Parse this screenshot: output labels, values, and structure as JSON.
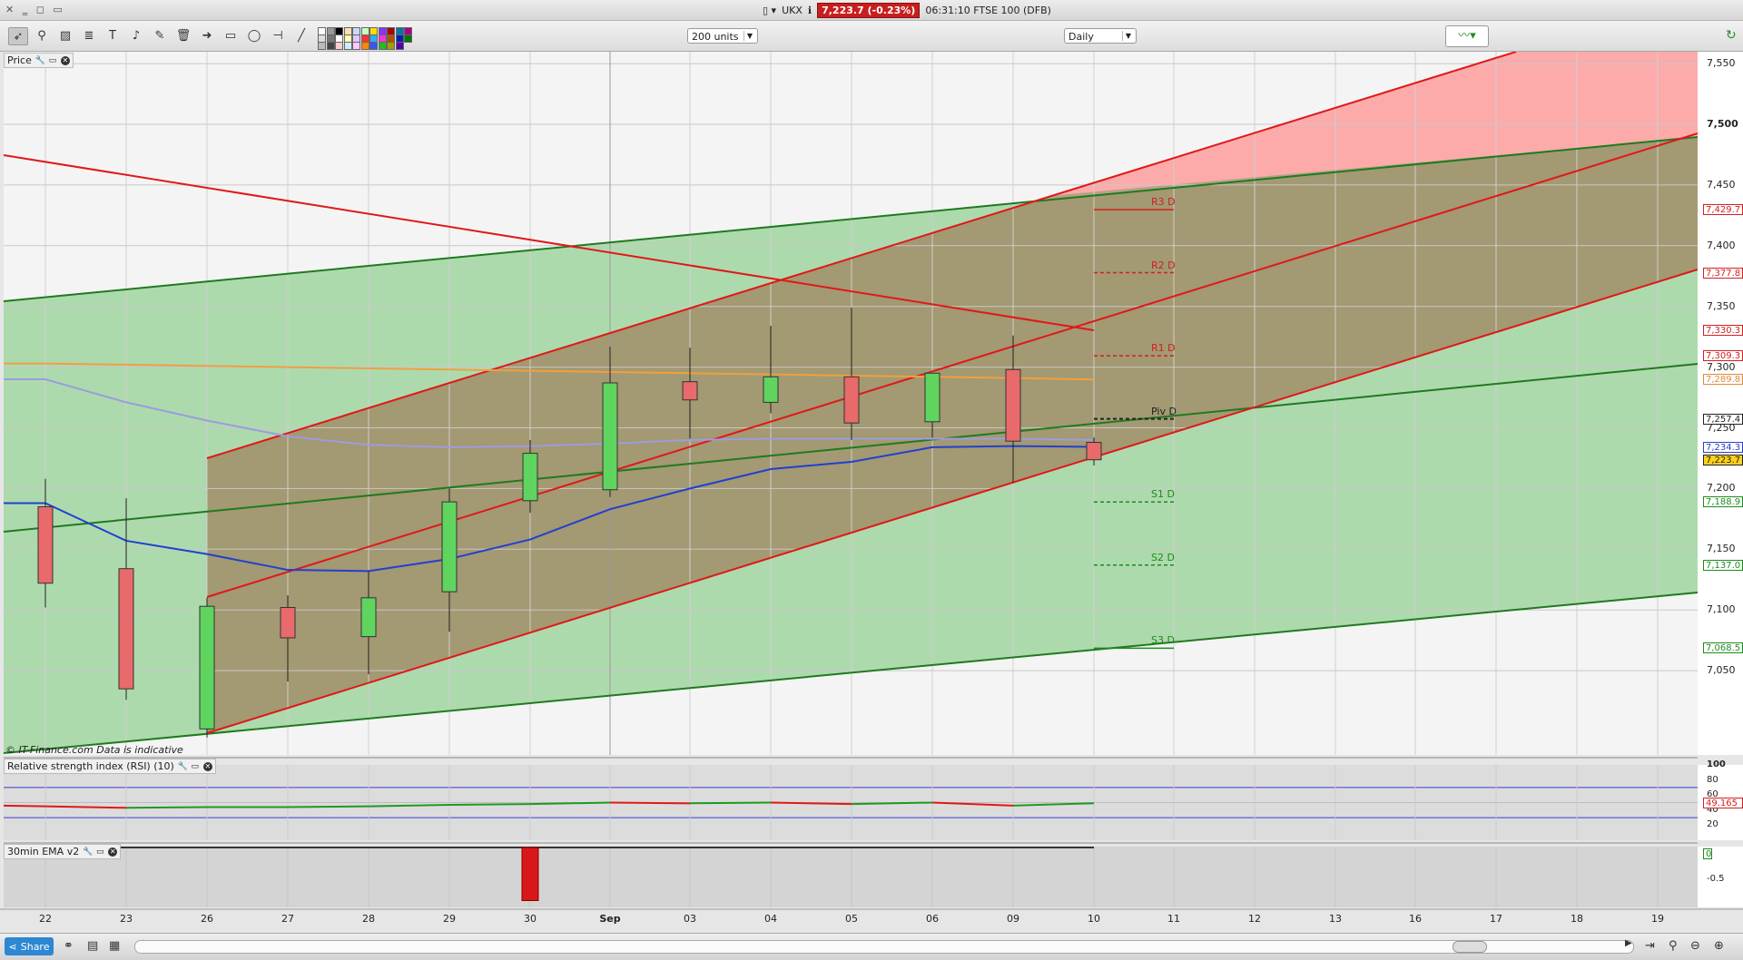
{
  "window": {
    "title": "UKX",
    "price_badge": "7,223.7 (-0.23%)",
    "time_instrument": "06:31:10 FTSE 100 (DFB)"
  },
  "toolbar": {
    "units_select": "200 units",
    "interval_select": "Daily"
  },
  "price_panel": {
    "label": "Price",
    "copyright": "© IT-Finance.com  Data is indicative",
    "y_ticks": [
      "7,550",
      "7,500",
      "7,450",
      "7,400",
      "7,350",
      "7,300",
      "7,250",
      "7,200",
      "7,150",
      "7,100",
      "7,050"
    ],
    "price_tags": [
      {
        "text": "7,429.7",
        "color": "#d22020"
      },
      {
        "text": "7,377.8",
        "color": "#d22020"
      },
      {
        "text": "7,330.3",
        "color": "#d22020"
      },
      {
        "text": "7,309.3",
        "color": "#d22020"
      },
      {
        "text": "7,289.8",
        "color": "#e08a3a"
      },
      {
        "text": "7,257.4",
        "color": "#222222"
      },
      {
        "text": "7,234.3",
        "color": "#2c3fc8"
      },
      {
        "text": "7,223.7",
        "color": "#222222"
      },
      {
        "text": "7,188.9",
        "color": "#1f8a1f"
      },
      {
        "text": "7,137.0",
        "color": "#1f8a1f"
      },
      {
        "text": "7,068.5",
        "color": "#1f8a1f"
      }
    ],
    "pivots": [
      {
        "label": "R3 D",
        "color": "#d22020"
      },
      {
        "label": "R2 D",
        "color": "#d22020"
      },
      {
        "label": "R1 D",
        "color": "#d22020"
      },
      {
        "label": "Piv D",
        "color": "#222222"
      },
      {
        "label": "S1 D",
        "color": "#1f8a1f"
      },
      {
        "label": "S2 D",
        "color": "#1f8a1f"
      },
      {
        "label": "S3 D",
        "color": "#1f8a1f"
      }
    ]
  },
  "rsi_panel": {
    "label": "Relative strength index (RSI) (10)",
    "y_ticks": [
      "100",
      "80",
      "60",
      "40",
      "20"
    ],
    "value_tag": "49.165"
  },
  "ema_panel": {
    "label": "30min EMA v2",
    "value_tag": "0",
    "y_tick": "-0.5"
  },
  "x_axis": {
    "labels": [
      "22",
      "23",
      "26",
      "27",
      "28",
      "29",
      "30",
      "Sep",
      "03",
      "04",
      "05",
      "06",
      "09",
      "10",
      "11",
      "12",
      "13",
      "16",
      "17",
      "18",
      "19"
    ]
  },
  "chart_data": {
    "type": "candlestick",
    "categories": [
      "22",
      "23",
      "26",
      "27",
      "28",
      "29",
      "30",
      "Sep",
      "03",
      "04",
      "05",
      "06",
      "09",
      "10"
    ],
    "ohlc": [
      {
        "o": 7185,
        "h": 7208,
        "l": 7102,
        "c": 7122
      },
      {
        "o": 7134,
        "h": 7192,
        "l": 7026,
        "c": 7035
      },
      {
        "o": 7002,
        "h": 7110,
        "l": 6995,
        "c": 7103
      },
      {
        "o": 7102,
        "h": 7112,
        "l": 7041,
        "c": 7077
      },
      {
        "o": 7078,
        "h": 7132,
        "l": 7047,
        "c": 7110
      },
      {
        "o": 7115,
        "h": 7200,
        "l": 7082,
        "c": 7189
      },
      {
        "o": 7190,
        "h": 7240,
        "l": 7180,
        "c": 7229
      },
      {
        "o": 7199,
        "h": 7317,
        "l": 7193,
        "c": 7287
      },
      {
        "o": 7288,
        "h": 7316,
        "l": 7241,
        "c": 7273
      },
      {
        "o": 7271,
        "h": 7334,
        "l": 7262,
        "c": 7292
      },
      {
        "o": 7292,
        "h": 7349,
        "l": 7240,
        "c": 7254
      },
      {
        "o": 7255,
        "h": 7295,
        "l": 7242,
        "c": 7295
      },
      {
        "o": 7298,
        "h": 7326,
        "l": 7205,
        "c": 7239
      },
      {
        "o": 7238,
        "h": 7242,
        "l": 7219,
        "c": 7223.7
      }
    ],
    "ylim": [
      6990,
      7560
    ],
    "overlays": {
      "blue_ma": [
        7188,
        7157,
        7146,
        7133,
        7132,
        7142,
        7158,
        7183,
        7200,
        7216,
        7222,
        7234,
        7235,
        7234.3
      ],
      "lavender_ma": [
        7290,
        7271,
        7256,
        7243,
        7236,
        7234,
        7235,
        7237,
        7240,
        7241,
        7241,
        7241,
        7241,
        7240
      ],
      "orange_ma": [
        7303,
        7302,
        7301,
        7300,
        7299,
        7298,
        7297,
        7296,
        7295,
        7294,
        7293,
        7292,
        7291,
        7289.8
      ]
    },
    "pivot_levels": {
      "R3 D": 7429.7,
      "R2 D": 7377.8,
      "R1 D": 7309.3,
      "Piv D": 7257.4,
      "S1 D": 7188.9,
      "S2 D": 7137.0,
      "S3 D": 7068.5
    },
    "rsi": [
      45,
      43,
      44,
      44,
      45,
      47,
      48,
      50,
      49,
      50,
      48,
      50,
      46,
      49.165
    ],
    "ema_bars": [
      0,
      0,
      0,
      0,
      0,
      0,
      -0.9,
      0,
      0,
      0,
      0,
      0,
      0,
      0
    ]
  }
}
